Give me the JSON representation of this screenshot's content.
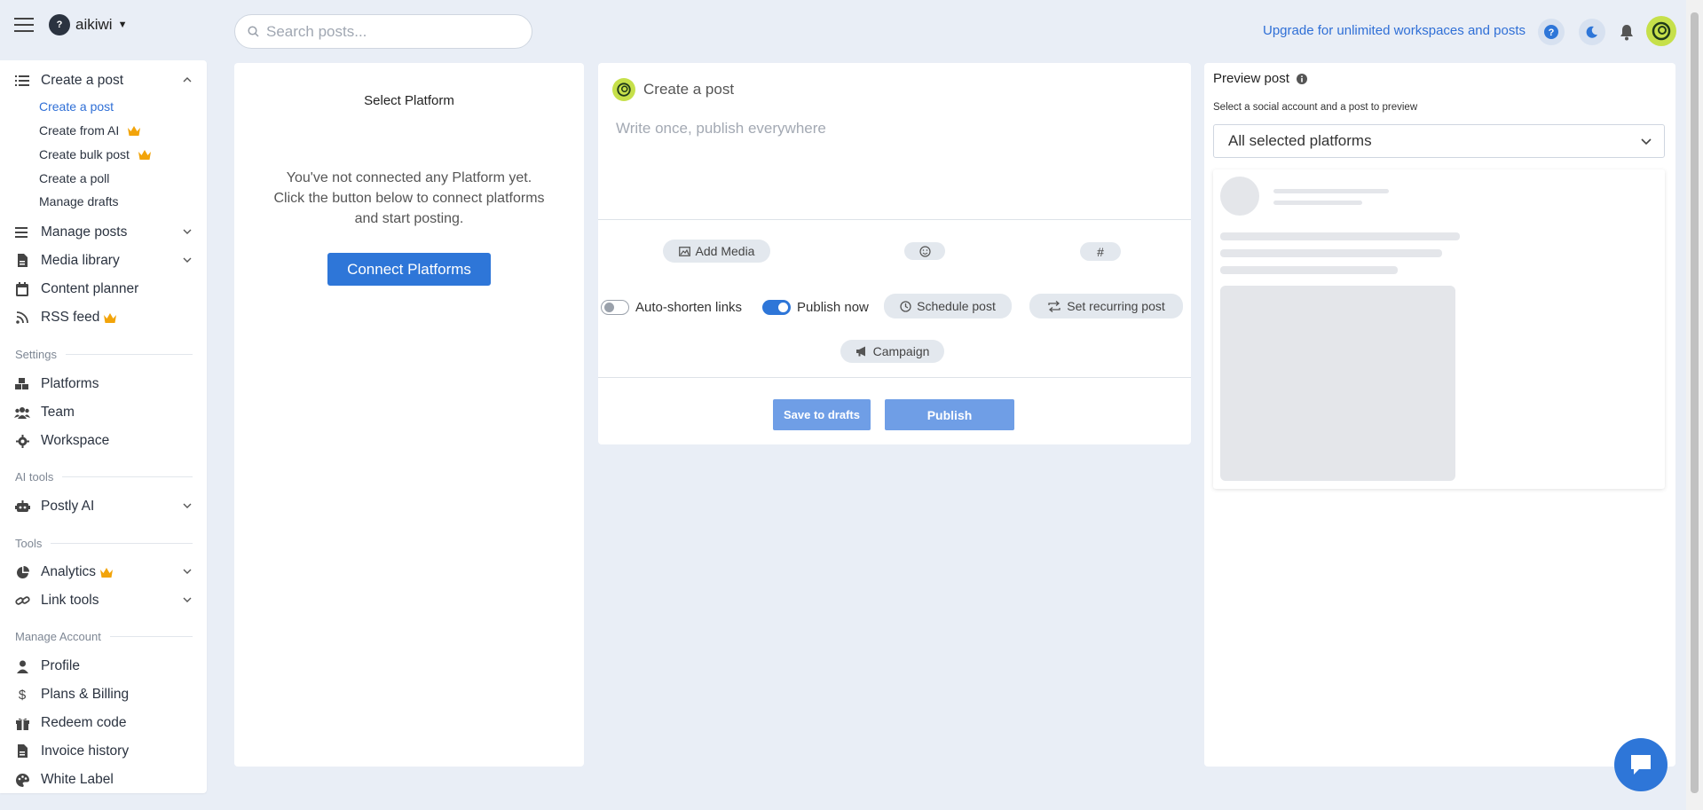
{
  "workspace": {
    "initial": "?",
    "name": "aikiwi"
  },
  "search": {
    "placeholder": "Search posts..."
  },
  "header": {
    "upgrade_text": "Upgrade for unlimited workspaces and posts"
  },
  "sidebar": {
    "create_post": {
      "label": "Create a post"
    },
    "create_items": [
      {
        "label": "Create a post",
        "active": true
      },
      {
        "label": "Create from AI",
        "premium": true
      },
      {
        "label": "Create bulk post",
        "premium": true
      },
      {
        "label": "Create a poll"
      },
      {
        "label": "Manage drafts"
      }
    ],
    "manage_posts": "Manage posts",
    "media_library": "Media library",
    "content_planner": "Content planner",
    "rss_feed": "RSS feed",
    "sections": {
      "settings": "Settings",
      "ai_tools": "AI tools",
      "tools": "Tools",
      "manage_account": "Manage Account"
    },
    "platforms": "Platforms",
    "team": "Team",
    "workspace": "Workspace",
    "postly_ai": "Postly AI",
    "analytics": "Analytics",
    "link_tools": "Link tools",
    "profile": "Profile",
    "plans_billing": "Plans & Billing",
    "redeem_code": "Redeem code",
    "invoice_history": "Invoice history",
    "white_label": "White Label"
  },
  "platform_panel": {
    "title": "Select Platform",
    "message": "You've not connected any Platform yet. Click the button below to connect platforms and start posting.",
    "connect_button": "Connect Platforms"
  },
  "create_panel": {
    "title": "Create a post",
    "placeholder": "Write once, publish everywhere",
    "add_media": "Add Media",
    "hashtag": "#",
    "auto_shorten_label": "Auto-shorten links",
    "auto_shorten": false,
    "publish_now_label": "Publish now",
    "publish_now": true,
    "schedule_post": "Schedule post",
    "set_recurring": "Set recurring post",
    "campaign": "Campaign",
    "save_drafts": "Save to drafts",
    "publish": "Publish"
  },
  "preview_panel": {
    "title": "Preview post",
    "subtitle": "Select a social account and a post to preview",
    "select_value": "All selected platforms"
  },
  "colors": {
    "accent": "#2e76d8",
    "brand": "#c6e04a",
    "crown": "#f2a40a",
    "background": "#e9eef6"
  }
}
